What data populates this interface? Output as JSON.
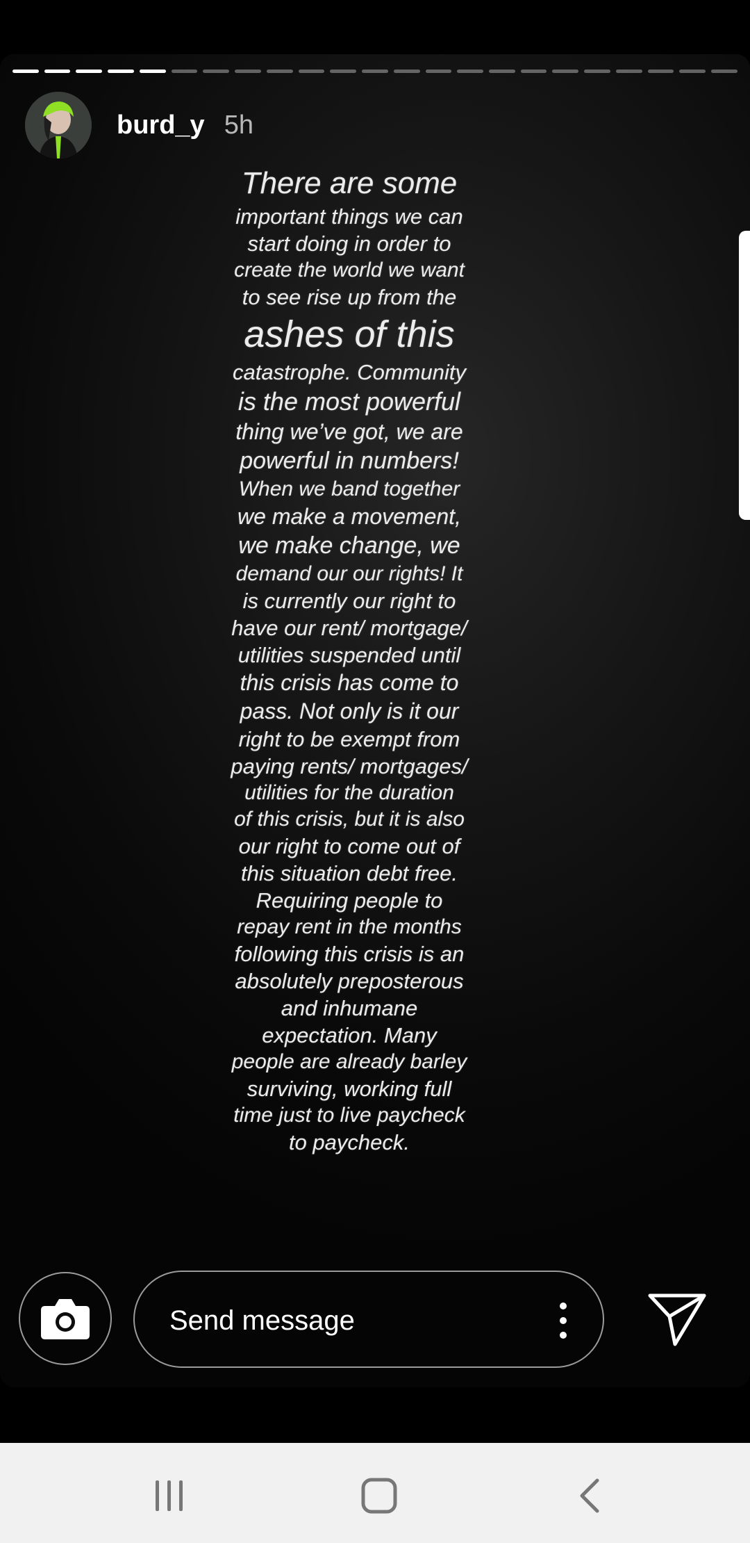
{
  "story": {
    "username": "burd_y",
    "time_ago": "5h",
    "progress": {
      "segments": 23,
      "completed": 5
    },
    "text_lines": [
      {
        "text": "There are some",
        "size": 44
      },
      {
        "text": "important things we can",
        "size": 31
      },
      {
        "text": "start doing in order to",
        "size": 31
      },
      {
        "text": "create the world we want",
        "size": 30
      },
      {
        "text": "to see rise up from the",
        "size": 31
      },
      {
        "text": "ashes of this",
        "size": 54
      },
      {
        "text": "catastrophe. Community",
        "size": 31
      },
      {
        "text": "is the most powerful",
        "size": 36
      },
      {
        "text": "thing we’ve got, we are",
        "size": 32
      },
      {
        "text": "powerful in numbers!",
        "size": 34
      },
      {
        "text": "When we band together",
        "size": 30
      },
      {
        "text": "we make a movement,",
        "size": 32
      },
      {
        "text": "we make change, we",
        "size": 34
      },
      {
        "text": "demand our our rights! It",
        "size": 30
      },
      {
        "text": "is currently our right to",
        "size": 31
      },
      {
        "text": "have our rent/ mortgage/",
        "size": 31
      },
      {
        "text": "utilities suspended until",
        "size": 31
      },
      {
        "text": "this crisis has come to",
        "size": 32
      },
      {
        "text": "pass. Not only is it our",
        "size": 32
      },
      {
        "text": "right to be exempt from",
        "size": 31
      },
      {
        "text": "paying rents/ mortgages/",
        "size": 31
      },
      {
        "text": "utilities for the duration",
        "size": 30
      },
      {
        "text": "of this crisis, but it is also",
        "size": 30
      },
      {
        "text": "our right to come out of",
        "size": 31
      },
      {
        "text": "this situation debt free.",
        "size": 31
      },
      {
        "text": "Requiring people to",
        "size": 31
      },
      {
        "text": "repay rent in the months",
        "size": 30
      },
      {
        "text": "following this crisis is an",
        "size": 31
      },
      {
        "text": "absolutely preposterous",
        "size": 31
      },
      {
        "text": "and inhumane",
        "size": 31
      },
      {
        "text": "expectation. Many",
        "size": 31
      },
      {
        "text": "people are already barley",
        "size": 30
      },
      {
        "text": "surviving, working full",
        "size": 31
      },
      {
        "text": "time just to live paycheck",
        "size": 30
      },
      {
        "text": "to paycheck.",
        "size": 31
      }
    ]
  },
  "composer": {
    "placeholder": "Send message",
    "camera_icon": "camera-icon",
    "more_icon": "more-vertical-icon",
    "send_icon": "send-icon"
  },
  "navbar": {
    "recents_icon": "recents-icon",
    "home_icon": "home-icon",
    "back_icon": "back-icon"
  },
  "colors": {
    "story_text": "#ececec",
    "navbar_bg": "#f1f1f1",
    "nav_icon": "#777777",
    "avatar_hair": "#8fe024"
  }
}
